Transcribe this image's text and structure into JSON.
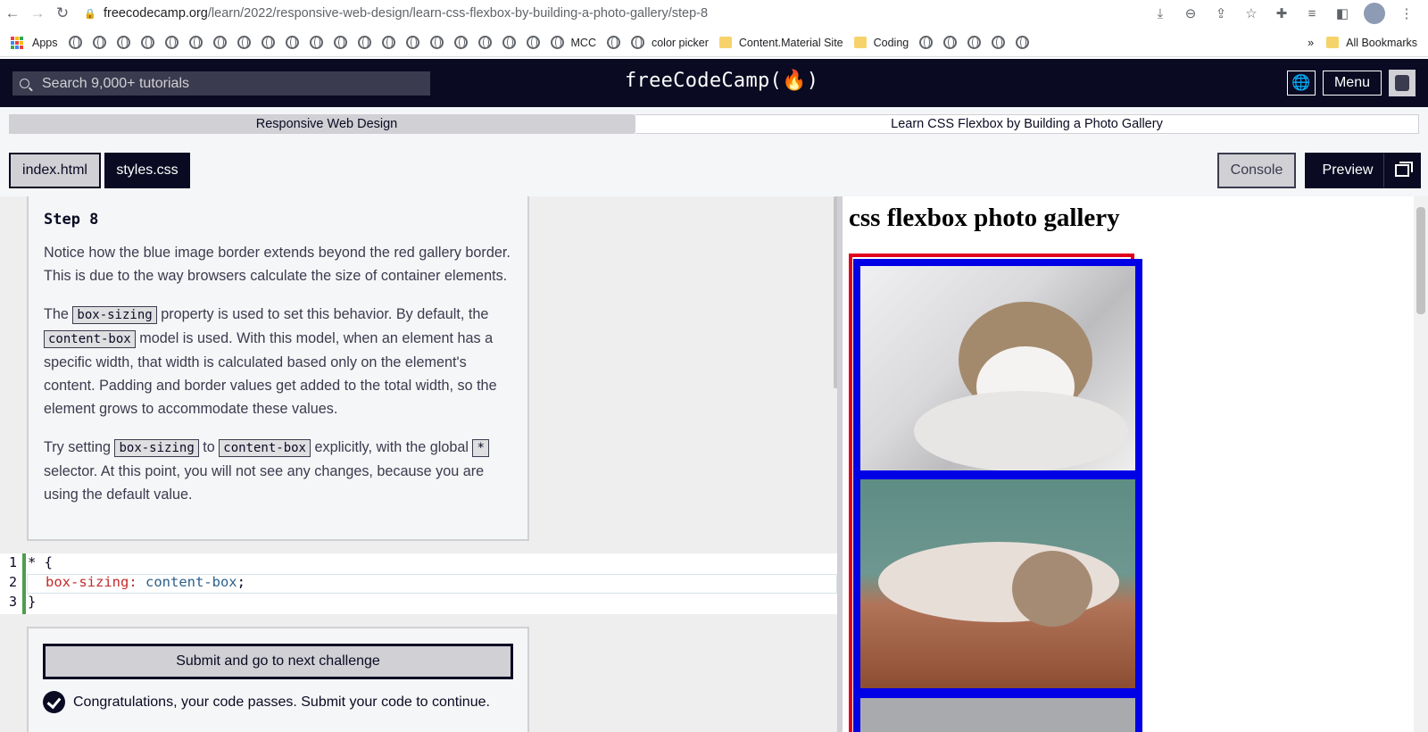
{
  "browser": {
    "url_host": "freecodecamp.org",
    "url_path": "/learn/2022/responsive-web-design/learn-css-flexbox-by-building-a-photo-gallery/step-8"
  },
  "bookmarks": {
    "apps_label": "Apps",
    "mcc_label": "MCC",
    "color_picker_label": "color picker",
    "content_material_label": "Content.Material Site",
    "coding_label": "Coding",
    "overflow_label": "»",
    "all_bookmarks_label": "All Bookmarks"
  },
  "nav": {
    "search_placeholder": "Search 9,000+ tutorials",
    "logo_text": "freeCodeCamp(🔥)",
    "menu_label": "Menu"
  },
  "breadcrumb": {
    "superblock": "Responsive Web Design",
    "block": "Learn CSS Flexbox by Building a Photo Gallery"
  },
  "tabs": {
    "index": "index.html",
    "styles": "styles.css",
    "console": "Console",
    "preview": "Preview"
  },
  "instructions": {
    "title": "Step 8",
    "p1": "Notice how the blue image border extends beyond the red gallery border. This is due to the way browsers calculate the size of container elements.",
    "p2_a": "The ",
    "p2_code1": "box-sizing",
    "p2_b": " property is used to set this behavior. By default, the ",
    "p2_code2": "content-box",
    "p2_c": " model is used. With this model, when an element has a specific width, that width is calculated based only on the element's content. Padding and border values get added to the total width, so the element grows to accommodate these values.",
    "p3_a": "Try setting ",
    "p3_code1": "box-sizing",
    "p3_b": " to ",
    "p3_code2": "content-box",
    "p3_c": " explicitly, with the global ",
    "p3_code3": "*",
    "p3_d": " selector. At this point, you will not see any changes, because you are using the default value."
  },
  "editor": {
    "line_numbers": [
      "1",
      "2",
      "3"
    ],
    "line1": "* {",
    "line2_prop": "box-sizing:",
    "line2_val": " content-box",
    "line2_end": ";",
    "line3": "}"
  },
  "submit": {
    "button_label": "Submit and go to next challenge",
    "pass_message": "Congratulations, your code passes. Submit your code to continue."
  },
  "preview": {
    "heading": "css flexbox photo gallery"
  },
  "colors": {
    "fcc_dark": "#0a0a23",
    "gallery_border": "#e0001b",
    "image_border": "#0000e6",
    "pass_green": "#4d9e4f"
  }
}
